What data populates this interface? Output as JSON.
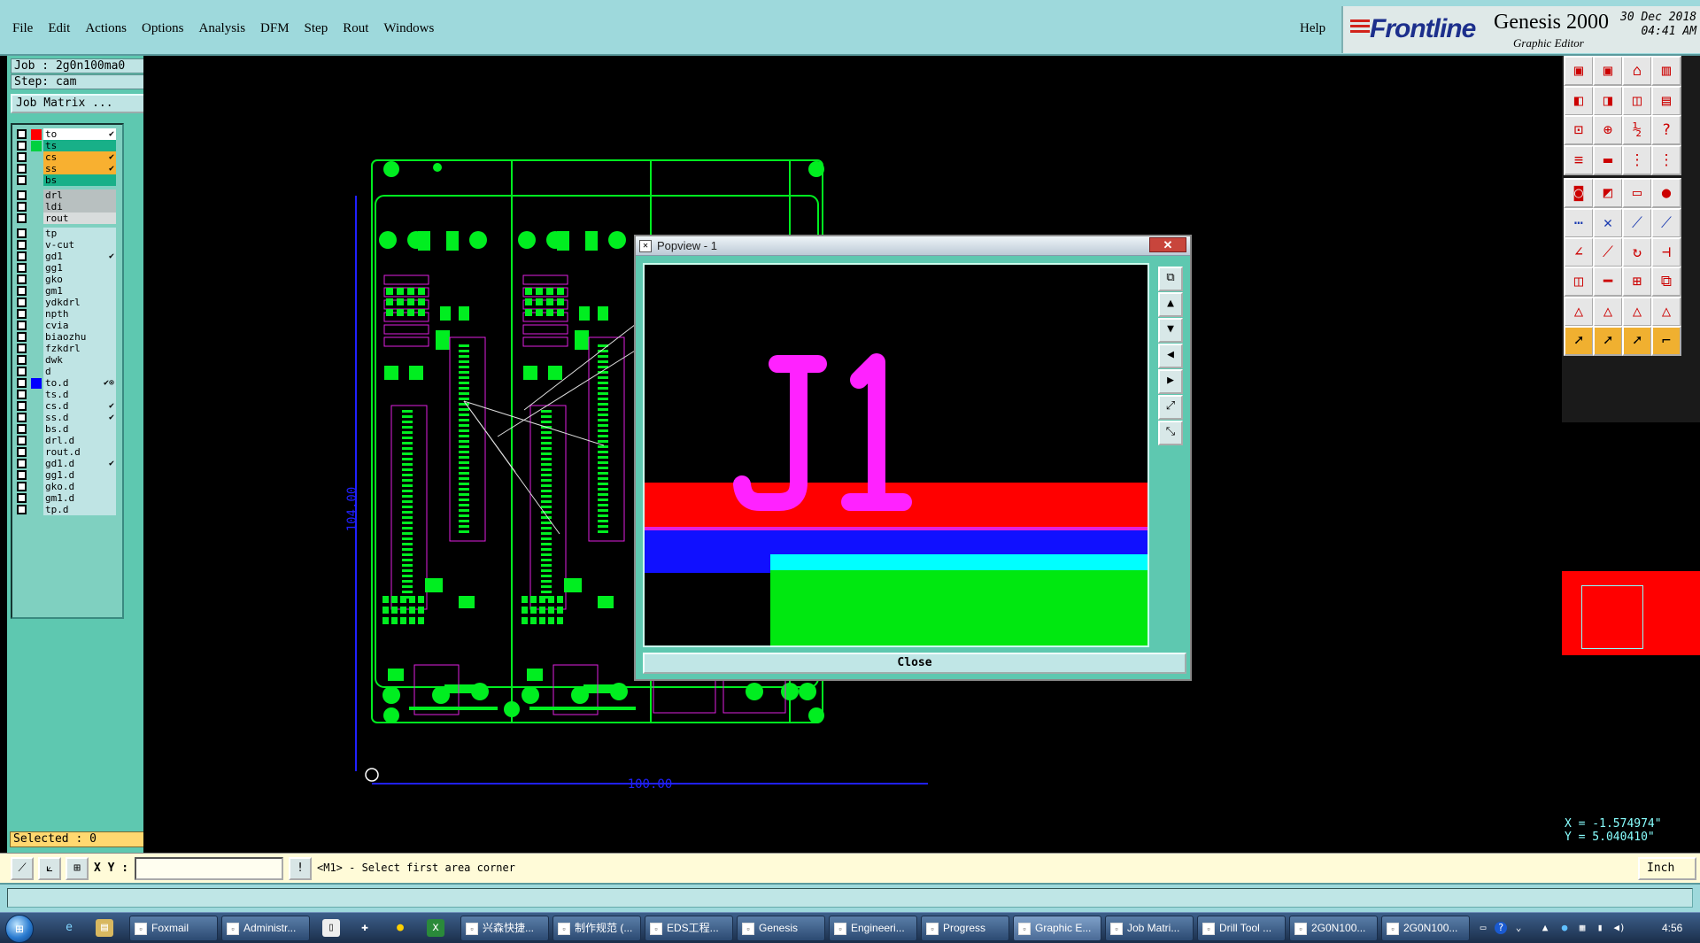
{
  "menubar": {
    "items": [
      "File",
      "Edit",
      "Actions",
      "Options",
      "Analysis",
      "DFM",
      "Step",
      "Rout",
      "Windows"
    ],
    "help": "Help"
  },
  "brand": {
    "logo": "Frontline",
    "product": "Genesis 2000",
    "subtitle": "Graphic Editor",
    "date": "30 Dec 2018",
    "time": "04:41 AM"
  },
  "job": {
    "job_line": "Job : 2g0n100ma0",
    "step_line": "Step: cam",
    "job_matrix_button": "Job Matrix ..."
  },
  "layers": [
    {
      "name": "to",
      "color": "#ff0000",
      "bg": "#ffffff",
      "flag": "✔",
      "group": 0
    },
    {
      "name": "ts",
      "color": "#00d040",
      "bg": "#18b088",
      "flag": "",
      "group": 0
    },
    {
      "name": "cs",
      "color": "",
      "bg": "#f8b030",
      "flag": "✔",
      "group": 0
    },
    {
      "name": "ss",
      "color": "",
      "bg": "#f8b030",
      "flag": "✔",
      "group": 0
    },
    {
      "name": "bs",
      "color": "",
      "bg": "#18b088",
      "flag": "",
      "group": 0
    },
    {
      "name": "drl",
      "color": "",
      "bg": "#b8c0c0",
      "flag": "",
      "group": 1
    },
    {
      "name": "ldi",
      "color": "",
      "bg": "#b8c0c0",
      "flag": "",
      "group": 1
    },
    {
      "name": "rout",
      "color": "",
      "bg": "#d8dcdc",
      "flag": "",
      "group": 1
    },
    {
      "name": "tp",
      "color": "",
      "bg": "#bfe4e4",
      "flag": "",
      "group": 2
    },
    {
      "name": "v-cut",
      "color": "",
      "bg": "#bfe4e4",
      "flag": "",
      "group": 2
    },
    {
      "name": "gd1",
      "color": "",
      "bg": "#bfe4e4",
      "flag": "✔",
      "group": 2
    },
    {
      "name": "gg1",
      "color": "",
      "bg": "#bfe4e4",
      "flag": "",
      "group": 2
    },
    {
      "name": "gko",
      "color": "",
      "bg": "#bfe4e4",
      "flag": "",
      "group": 2
    },
    {
      "name": "gm1",
      "color": "",
      "bg": "#bfe4e4",
      "flag": "",
      "group": 2
    },
    {
      "name": "ydkdrl",
      "color": "",
      "bg": "#bfe4e4",
      "flag": "",
      "group": 2
    },
    {
      "name": "npth",
      "color": "",
      "bg": "#bfe4e4",
      "flag": "",
      "group": 2
    },
    {
      "name": "cvia",
      "color": "",
      "bg": "#bfe4e4",
      "flag": "",
      "group": 2
    },
    {
      "name": "biaozhu",
      "color": "",
      "bg": "#bfe4e4",
      "flag": "",
      "group": 2
    },
    {
      "name": "fzkdrl",
      "color": "",
      "bg": "#bfe4e4",
      "flag": "",
      "group": 2
    },
    {
      "name": "dwk",
      "color": "",
      "bg": "#bfe4e4",
      "flag": "",
      "group": 2
    },
    {
      "name": "d",
      "color": "",
      "bg": "#bfe4e4",
      "flag": "",
      "group": 2
    },
    {
      "name": "to.d",
      "color": "#0000ff",
      "bg": "#bfe4e4",
      "flag": "✔⊗",
      "group": 2
    },
    {
      "name": "ts.d",
      "color": "",
      "bg": "#bfe4e4",
      "flag": "",
      "group": 2
    },
    {
      "name": "cs.d",
      "color": "",
      "bg": "#bfe4e4",
      "flag": "✔",
      "group": 2
    },
    {
      "name": "ss.d",
      "color": "",
      "bg": "#bfe4e4",
      "flag": "✔",
      "group": 2
    },
    {
      "name": "bs.d",
      "color": "",
      "bg": "#bfe4e4",
      "flag": "",
      "group": 2
    },
    {
      "name": "drl.d",
      "color": "",
      "bg": "#bfe4e4",
      "flag": "",
      "group": 2
    },
    {
      "name": "rout.d",
      "color": "",
      "bg": "#bfe4e4",
      "flag": "",
      "group": 2
    },
    {
      "name": "gd1.d",
      "color": "",
      "bg": "#bfe4e4",
      "flag": "✔",
      "group": 2
    },
    {
      "name": "gg1.d",
      "color": "",
      "bg": "#bfe4e4",
      "flag": "",
      "group": 2
    },
    {
      "name": "gko.d",
      "color": "",
      "bg": "#bfe4e4",
      "flag": "",
      "group": 2
    },
    {
      "name": "gm1.d",
      "color": "",
      "bg": "#bfe4e4",
      "flag": "",
      "group": 2
    },
    {
      "name": "tp.d",
      "color": "",
      "bg": "#bfe4e4",
      "flag": "",
      "group": 2
    }
  ],
  "selected": "Selected : 0",
  "board": {
    "dim_vertical": "104.00",
    "dim_horizontal": "100.00"
  },
  "popview": {
    "title": "Popview - 1",
    "close_x": "✕",
    "close_button": "Close",
    "designator": "J1"
  },
  "coords": {
    "x": "X = -1.574974\"",
    "y": "Y = 5.040410\""
  },
  "command": {
    "xy_label": "X Y :",
    "xy_value": "",
    "prompt": "<M1> - Select first area corner",
    "units": "Inch"
  },
  "taskbar": {
    "tasks": [
      {
        "label": "Foxmail",
        "active": false
      },
      {
        "label": "Administr...",
        "active": false
      },
      {
        "label": "兴森快捷...",
        "active": false
      },
      {
        "label": "制作规范 (...",
        "active": false
      },
      {
        "label": "EDS工程...",
        "active": false
      },
      {
        "label": "Genesis",
        "active": false
      },
      {
        "label": "Engineeri...",
        "active": false
      },
      {
        "label": "Progress",
        "active": false
      },
      {
        "label": "Graphic E...",
        "active": true
      },
      {
        "label": "Job Matri...",
        "active": false
      },
      {
        "label": "Drill Tool ...",
        "active": false
      },
      {
        "label": "2G0N100...",
        "active": false
      },
      {
        "label": "2G0N100...",
        "active": false
      }
    ],
    "clock": "4:56"
  },
  "colors": {
    "pcb_green": "#00ee20",
    "pcb_magenta": "#e020e0",
    "dimension_blue": "#2020ff",
    "pv_red": "#ff0000",
    "pv_blue": "#1010ff",
    "pv_cyan": "#00ffff",
    "pv_green": "#00e810"
  }
}
